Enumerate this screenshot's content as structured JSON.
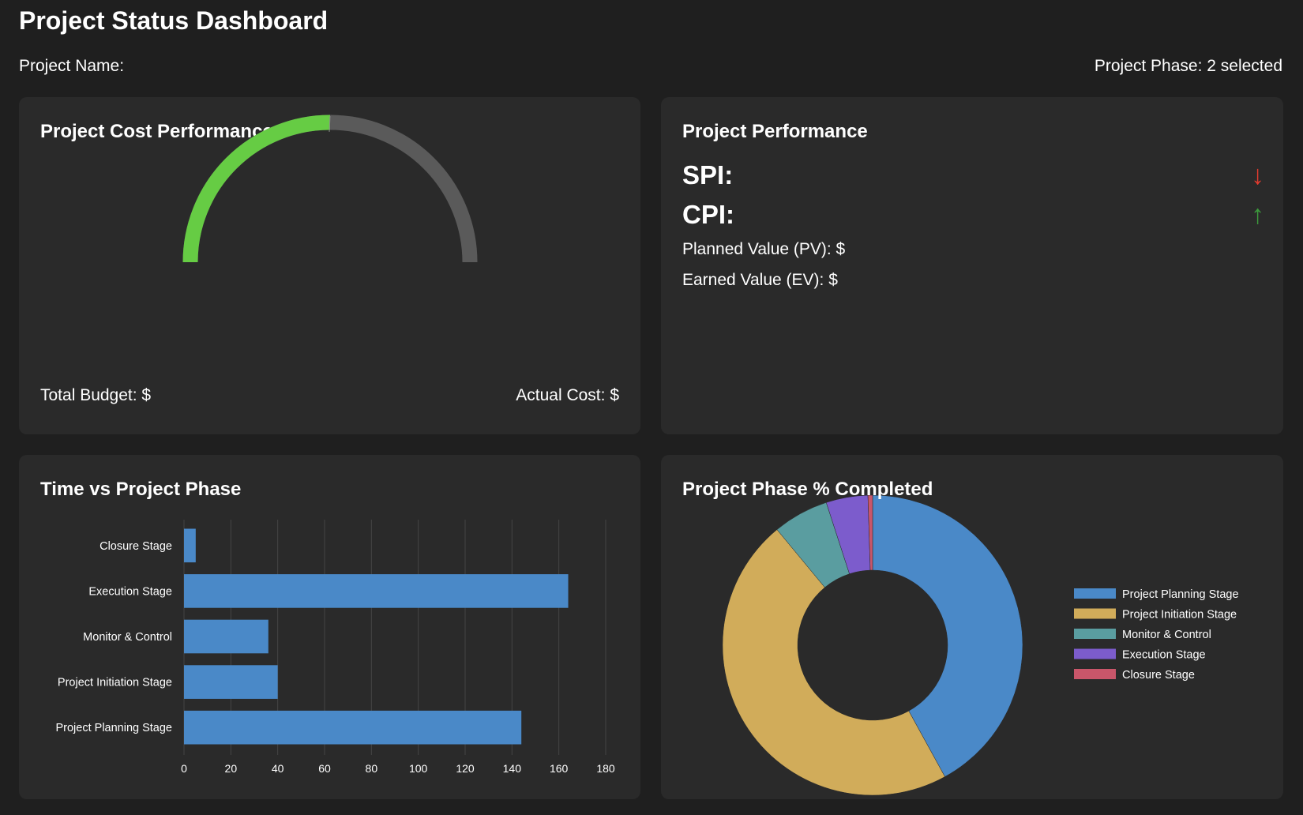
{
  "header": {
    "title": "Project Status Dashboard",
    "project_name_label": "Project Name:",
    "project_phase_label": "Project Phase: 2 selected"
  },
  "cost_card": {
    "title": "Project Cost Performance",
    "total_budget_label": "Total Budget: $",
    "actual_cost_label": "Actual Cost: $",
    "gauge_fraction": 0.5,
    "gauge_fill_color": "#66cc44",
    "gauge_track_color": "#5a5a5a"
  },
  "perf_card": {
    "title": "Project Performance",
    "spi_label": "SPI:",
    "cpi_label": "CPI:",
    "spi_arrow": "↓",
    "cpi_arrow": "↑",
    "spi_arrow_color": "#e23b2e",
    "cpi_arrow_color": "#3c9a3c",
    "pv_label": "Planned Value (PV): $",
    "ev_label": "Earned Value (EV): $"
  },
  "time_card": {
    "title": "Time vs Project Phase"
  },
  "pie_card": {
    "title": "Project Phase % Completed"
  },
  "chart_data": [
    {
      "type": "bar",
      "orientation": "horizontal",
      "categories": [
        "Closure Stage",
        "Execution Stage",
        "Monitor & Control",
        "Project Initiation Stage",
        "Project Planning Stage"
      ],
      "values": [
        5,
        164,
        36,
        40,
        144
      ],
      "xlim": [
        0,
        180
      ],
      "xticks": [
        0,
        20,
        40,
        60,
        80,
        100,
        120,
        140,
        160,
        180
      ],
      "grid": true,
      "color": "#4a89c8"
    },
    {
      "type": "pie",
      "donut": true,
      "labels": [
        "Project Planning Stage",
        "Project Initiation Stage",
        "Monitor & Control",
        "Execution Stage",
        "Closure Stage"
      ],
      "values": [
        42,
        47,
        6,
        4.5,
        0.5
      ],
      "colors": [
        "#4a89c8",
        "#d1ac5a",
        "#5a9da0",
        "#7c5ccc",
        "#c9566a"
      ],
      "legend": "right"
    }
  ]
}
